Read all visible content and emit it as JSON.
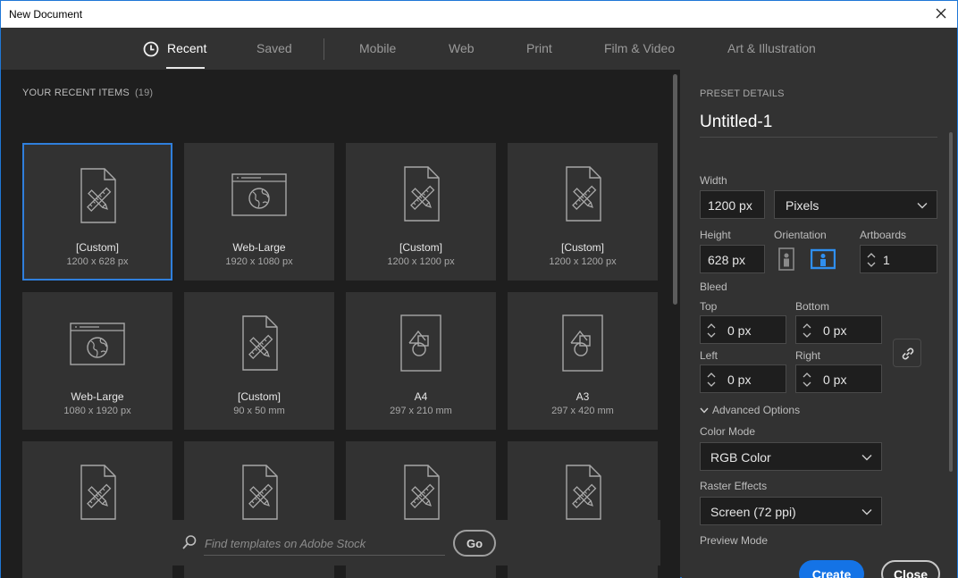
{
  "window": {
    "title": "New Document"
  },
  "tabs": [
    {
      "label": "Recent",
      "active": true
    },
    {
      "label": "Saved",
      "active": false
    },
    {
      "label": "Mobile",
      "active": false
    },
    {
      "label": "Web",
      "active": false
    },
    {
      "label": "Print",
      "active": false
    },
    {
      "label": "Film & Video",
      "active": false
    },
    {
      "label": "Art & Illustration",
      "active": false
    }
  ],
  "recent": {
    "header": "YOUR RECENT ITEMS",
    "count": "(19)",
    "items": [
      {
        "name": "[Custom]",
        "size": "1200 x 628 px",
        "icon": "document-custom-icon",
        "selected": true
      },
      {
        "name": "Web-Large",
        "size": "1920 x 1080 px",
        "icon": "web-globe-icon"
      },
      {
        "name": "[Custom]",
        "size": "1200 x 1200 px",
        "icon": "document-custom-icon"
      },
      {
        "name": "[Custom]",
        "size": "1200 x 1200 px",
        "icon": "document-custom-icon"
      },
      {
        "name": "Web-Large",
        "size": "1080 x 1920 px",
        "icon": "web-globe-icon"
      },
      {
        "name": "[Custom]",
        "size": "90 x 50 mm",
        "icon": "document-custom-icon"
      },
      {
        "name": "A4",
        "size": "297 x 210 mm",
        "icon": "print-shapes-icon"
      },
      {
        "name": "A3",
        "size": "297 x 420 mm",
        "icon": "print-shapes-icon"
      },
      {
        "name": "",
        "size": "",
        "icon": "document-custom-icon"
      },
      {
        "name": "",
        "size": "",
        "icon": "document-custom-icon"
      },
      {
        "name": "",
        "size": "",
        "icon": "document-custom-icon"
      },
      {
        "name": "",
        "size": "",
        "icon": "document-custom-icon"
      }
    ]
  },
  "stock": {
    "placeholder": "Find templates on Adobe Stock",
    "go_label": "Go"
  },
  "preset": {
    "section_title": "PRESET DETAILS",
    "doc_name": "Untitled-1",
    "width_label": "Width",
    "width_value": "1200 px",
    "units_value": "Pixels",
    "height_label": "Height",
    "height_value": "628 px",
    "orientation_label": "Orientation",
    "orientation_selected": "landscape",
    "artboards_label": "Artboards",
    "artboards_value": "1",
    "bleed_label": "Bleed",
    "top_label": "Top",
    "top_value": "0 px",
    "bottom_label": "Bottom",
    "bottom_value": "0 px",
    "left_label": "Left",
    "left_value": "0 px",
    "right_label": "Right",
    "right_value": "0 px",
    "advanced_label": "Advanced Options",
    "color_mode_label": "Color Mode",
    "color_mode_value": "RGB Color",
    "raster_label": "Raster Effects",
    "raster_value": "Screen (72 ppi)",
    "preview_label": "Preview Mode"
  },
  "actions": {
    "create_label": "Create",
    "close_label": "Close"
  },
  "colors": {
    "accent": "#1473e6",
    "selected_border": "#2f7fdc",
    "panel": "#323232",
    "grid_bg": "#1e1e1e"
  }
}
